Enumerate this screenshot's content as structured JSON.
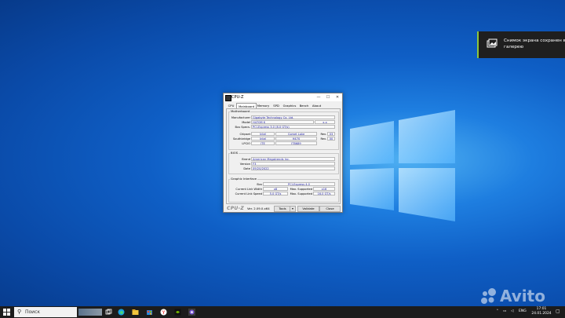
{
  "notification": {
    "text": "Снимок экрана сохранен в галерею"
  },
  "window": {
    "title": "CPU-Z",
    "controls": {
      "minimize": "—",
      "maximize": "☐",
      "close": "✕"
    },
    "tabs": [
      "CPU",
      "Mainboard",
      "Memory",
      "SPD",
      "Graphics",
      "Bench",
      "About"
    ],
    "active_tab": "Mainboard",
    "motherboard": {
      "group_label": "Motherboard",
      "manufacturer_label": "Manufacturer",
      "manufacturer": "Gigabyte Technology Co. Ltd.",
      "model_label": "Model",
      "model": "H470M K",
      "model_rev": "x.x",
      "bus_specs_label": "Bus Specs.",
      "bus_specs": "PCI-Express 3.0 (8.0 GT/s)",
      "chipset_label": "Chipset",
      "chipset_vendor": "Intel",
      "chipset_name": "Comet Lake",
      "chipset_rev_label": "Rev.",
      "chipset_rev": "03",
      "southbridge_label": "Southbridge",
      "southbridge_vendor": "Intel",
      "southbridge_name": "H470",
      "southbridge_rev_label": "Rev.",
      "southbridge_rev": "00",
      "lpcio_label": "LPCIO",
      "lpcio_vendor": "ITE",
      "lpcio_name": "IT8689"
    },
    "bios": {
      "group_label": "BIOS",
      "brand_label": "Brand",
      "brand": "American Megatrends Inc.",
      "version_label": "Version",
      "version": "F3",
      "date_label": "Date",
      "date": "09/20/2022"
    },
    "graphic_interface": {
      "group_label": "Graphic Interface",
      "bus_label": "Bus",
      "bus": "PCI-Express 4.0",
      "link_width_label": "Current Link Width",
      "link_width": "x8",
      "max_width_label": "Max. Supported",
      "max_width": "x16",
      "link_speed_label": "Current Link Speed",
      "link_speed": "5.0 GT/s",
      "max_speed_label": "Max. Supported",
      "max_speed": "16.0 GT/s"
    },
    "footer": {
      "brand": "CPU-Z",
      "version": "Ver. 2.09.0.x64",
      "tools_label": "Tools",
      "validate_label": "Validate",
      "close_label": "Close"
    }
  },
  "taskbar": {
    "search_placeholder": "Поиск",
    "language": "ENG",
    "time": "17:01",
    "date": "24.01.2024"
  },
  "watermark": "Avito",
  "colors": {
    "accent_green": "#8dc63f",
    "value_text": "#1a1aa0",
    "taskbar": "#1c1c1c"
  }
}
